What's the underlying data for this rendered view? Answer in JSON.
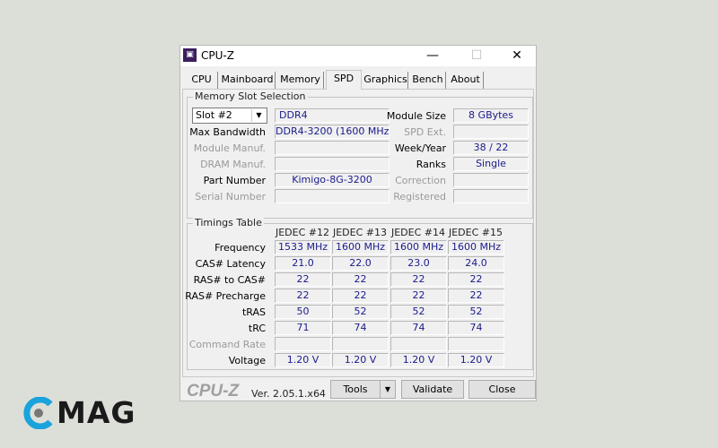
{
  "window": {
    "title": "CPU-Z",
    "icon": "cpu-z-app-icon",
    "minimize": "—",
    "maximize": "☐",
    "close": "✕"
  },
  "tabs": [
    "CPU",
    "Mainboard",
    "Memory",
    "SPD",
    "Graphics",
    "Bench",
    "About"
  ],
  "active_tab": "SPD",
  "slot": {
    "group_title": "Memory Slot Selection",
    "selected_slot": "Slot #2",
    "type": "DDR4",
    "max_bandwidth_label": "Max Bandwidth",
    "max_bandwidth": "DDR4-3200 (1600 MHz)",
    "module_manuf_label": "Module Manuf.",
    "module_manuf": "",
    "dram_manuf_label": "DRAM Manuf.",
    "dram_manuf": "",
    "part_number_label": "Part Number",
    "part_number": "Kimigo-8G-3200",
    "serial_number_label": "Serial Number",
    "serial_number": "",
    "module_size_label": "Module Size",
    "module_size": "8 GBytes",
    "spd_ext_label": "SPD Ext.",
    "spd_ext": "",
    "week_year_label": "Week/Year",
    "week_year": "38 / 22",
    "ranks_label": "Ranks",
    "ranks": "Single",
    "correction_label": "Correction",
    "correction": "",
    "registered_label": "Registered",
    "registered": ""
  },
  "timings": {
    "group_title": "Timings Table",
    "columns": [
      "JEDEC #12",
      "JEDEC #13",
      "JEDEC #14",
      "JEDEC #15"
    ],
    "rows": [
      {
        "label": "Frequency",
        "values": [
          "1533 MHz",
          "1600 MHz",
          "1600 MHz",
          "1600 MHz"
        ]
      },
      {
        "label": "CAS# Latency",
        "values": [
          "21.0",
          "22.0",
          "23.0",
          "24.0"
        ]
      },
      {
        "label": "RAS# to CAS#",
        "values": [
          "22",
          "22",
          "22",
          "22"
        ]
      },
      {
        "label": "RAS# Precharge",
        "values": [
          "22",
          "22",
          "22",
          "22"
        ]
      },
      {
        "label": "tRAS",
        "values": [
          "50",
          "52",
          "52",
          "52"
        ]
      },
      {
        "label": "tRC",
        "values": [
          "71",
          "74",
          "74",
          "74"
        ]
      },
      {
        "label": "Command Rate",
        "values": [
          "",
          "",
          "",
          ""
        ],
        "disabled": true
      },
      {
        "label": "Voltage",
        "values": [
          "1.20 V",
          "1.20 V",
          "1.20 V",
          "1.20 V"
        ]
      }
    ]
  },
  "footer": {
    "logo": "CPU-Z",
    "version": "Ver. 2.05.1.x64",
    "tools": "Tools",
    "validate": "Validate",
    "close": "Close"
  },
  "watermark": {
    "text": "MAG",
    "accent": "#1aa3dc"
  }
}
